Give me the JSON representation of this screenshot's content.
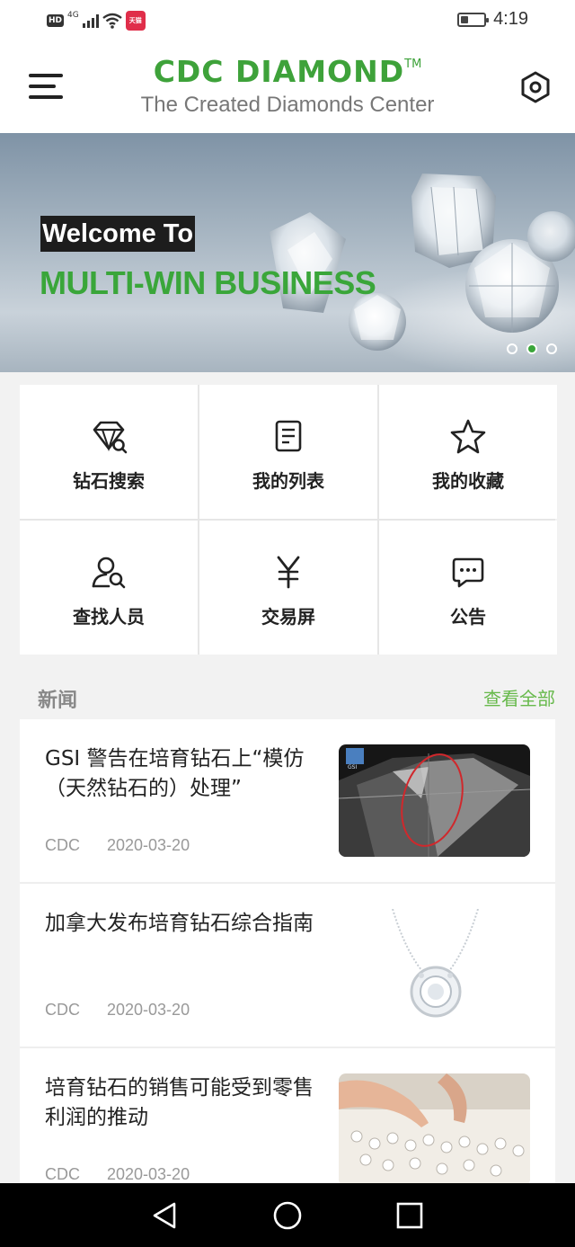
{
  "status_bar": {
    "hd": "HD",
    "network": "4G",
    "app_badge_text": "天猫",
    "time": "4:19",
    "battery_level": 0.35
  },
  "header": {
    "brand": "CDC DIAMOND",
    "trademark": "TM",
    "subtitle": "The Created Diamonds Center",
    "brand_color": "#3ea23a",
    "menu_icon": "hamburger-icon",
    "settings_icon": "hexagon-settings-icon"
  },
  "banner": {
    "welcome": "Welcome To",
    "headline": "MULTI-WIN BUSINESS",
    "slide_count": 3,
    "active_slide": 2
  },
  "grid": {
    "items": [
      {
        "label": "钻石搜索",
        "icon": "diamond-search-icon"
      },
      {
        "label": "我的列表",
        "icon": "list-document-icon"
      },
      {
        "label": "我的收藏",
        "icon": "star-icon"
      },
      {
        "label": "查找人员",
        "icon": "person-search-icon"
      },
      {
        "label": "交易屏",
        "icon": "yen-icon"
      },
      {
        "label": "公告",
        "icon": "message-bubble-icon"
      }
    ]
  },
  "news": {
    "title": "新闻",
    "view_all": "查看全部",
    "accent_color": "#67b94b",
    "items": [
      {
        "title": "GSI 警告在培育钻石上“模仿（天然钻石的）处理”",
        "source": "CDC",
        "date": "2020-03-20",
        "thumb": "diamond-closeup-image"
      },
      {
        "title": "加拿大发布培育钻石综合指南",
        "source": "CDC",
        "date": "2020-03-20",
        "thumb": "diamond-necklace-image"
      },
      {
        "title": "培育钻石的销售可能受到零售利润的推动",
        "source": "CDC",
        "date": "2020-03-20",
        "thumb": "diamond-tray-image"
      }
    ]
  },
  "nav": {
    "back_icon": "back-triangle-icon",
    "home_icon": "home-circle-icon",
    "recents_icon": "recents-square-icon"
  }
}
